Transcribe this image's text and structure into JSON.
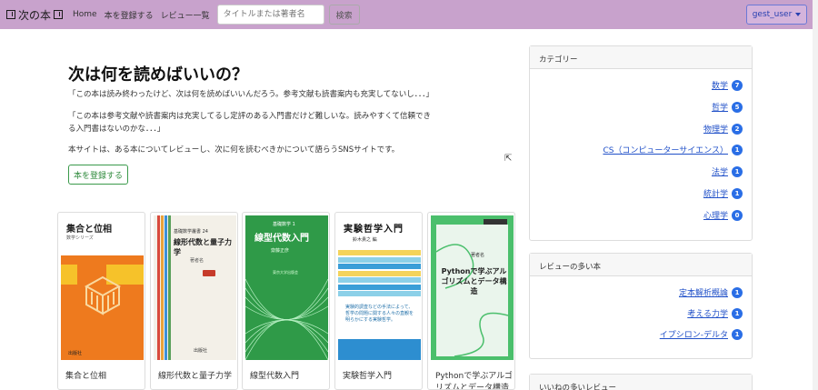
{
  "navbar": {
    "brand": "次の本",
    "links": [
      "Home",
      "本を登録する",
      "レビュー一覧"
    ],
    "search_placeholder": "タイトルまたは著者名",
    "search_button": "検索",
    "user": "gest_user"
  },
  "hero": {
    "title": "次は何を読めばいいの？",
    "quote1": "「この本は読み終わったけど、次は何を読めばいいんだろう。参考文献も読書案内も充実してないし．．．」",
    "quote2": "「この本は参考文献や読書案内は充実してるし定評のある入門書だけど難しいな。読みやすくて信頼できる入門書はないのかな．．．」",
    "about": "本サイトは、ある本についてレビューし、次に何を読むべきかについて語らうSNSサイトです。",
    "register_button": "本を登録する"
  },
  "books": [
    {
      "title": "集合と位相",
      "cover_title": "集合と位相",
      "cover_series": "数学シリーズ",
      "cover_author": "著者名",
      "cover_pub": "出版社"
    },
    {
      "title": "線形代数と量子力学",
      "cover_title": "線形代数と量子力学",
      "cover_series": "基礎数学叢書 24",
      "cover_author": "著者名",
      "cover_pub": "出版社"
    },
    {
      "title": "線型代数入門",
      "cover_title": "線型代数入門",
      "cover_series": "基礎数学 1",
      "cover_author": "齋藤正彦",
      "cover_pub": "東京大学出版会"
    },
    {
      "title": "実験哲学入門",
      "cover_title": "実験哲学入門",
      "cover_author": "鈴木貴之 編",
      "cover_blurb": "実験的調査などの手法によって、哲学の問題に関する人々の直観を明らかにする実験哲学。"
    },
    {
      "title": "Pythonで学ぶアルゴリズムとデータ構造",
      "cover_title": "Pythonで学ぶアルゴリズムとデータ構造",
      "cover_author": "著者名"
    }
  ],
  "sidebar": {
    "categories_title": "カテゴリー",
    "categories": [
      {
        "name": "数学",
        "count": "7"
      },
      {
        "name": "哲学",
        "count": "5"
      },
      {
        "name": "物理学",
        "count": "2"
      },
      {
        "name": "CS（コンピューターサイエンス）",
        "count": "1"
      },
      {
        "name": "法学",
        "count": "1"
      },
      {
        "name": "統計学",
        "count": "1"
      },
      {
        "name": "心理学",
        "count": "0"
      }
    ],
    "popular_books_title": "レビューの多い本",
    "popular_books": [
      {
        "name": "定本解析概論",
        "count": "1"
      },
      {
        "name": "考える力学",
        "count": "1"
      },
      {
        "name": "イプシロン-デルタ",
        "count": "1"
      }
    ],
    "liked_reviews_title": "いいねの多いレビュー"
  },
  "colors": {
    "navbar": "#c8a2cc",
    "link": "#2050c8",
    "badge": "#2a6ee6",
    "register_button": "#3a9a4a"
  }
}
